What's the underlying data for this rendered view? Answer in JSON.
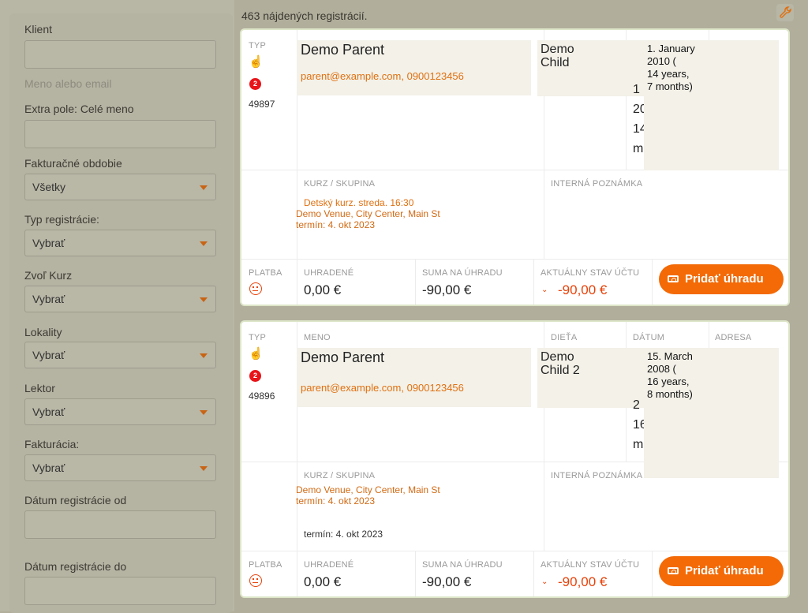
{
  "filters": {
    "client_label": "Klient",
    "client_hint": "Meno alebo email",
    "extra_label": "Extra pole: Celé meno",
    "period_label": "Fakturačné obdobie",
    "period_value": "Všetky",
    "regtype_label": "Typ registrácie:",
    "regtype_value": "Vybrať",
    "course_label": "Zvoľ Kurz",
    "course_value": "Vybrať",
    "location_label": "Lokality",
    "location_value": "Vybrať",
    "lector_label": "Lektor",
    "lector_value": "Vybrať",
    "billing_label": "Fakturácia:",
    "billing_value": "Vybrať",
    "date_from_label": "Dátum registrácie od",
    "date_to_label": "Dátum registrácie do"
  },
  "results_count": "463 nájdených registrácií.",
  "columns": {
    "typ": "TYP",
    "meno": "MENO",
    "dieta": "DIEŤA",
    "datum": "DÁTUM",
    "adresa": "ADRESA",
    "kurz": "KURZ / SKUPINA",
    "poznamka": "INTERNÁ POZNÁMKA",
    "platba": "PLATBA",
    "uhradene": "UHRADENÉ",
    "suma": "SUMA NA ÚHRADU",
    "stav": "AKTUÁLNY STAV ÚČTU"
  },
  "registrations": [
    {
      "id": "49897",
      "badge": "2",
      "parent": "Demo Parent",
      "contact": "parent@example.com, 0900123456",
      "child": "Demo\nChild",
      "birth": "1. January\n2010 (\n14 years,\n7 months)",
      "birth_cut": "1\n20\n14\nm",
      "course_link": "Detský kurz. streda. 16:30",
      "venue": "Demo Venue, City Center, Main St",
      "term": "termín: 4. okt 2023",
      "term_extra": "",
      "paid": "0,00 €",
      "due": "-90,00 €",
      "balance": "-90,00 €",
      "button": "Pridať úhradu"
    },
    {
      "id": "49896",
      "badge": "2",
      "parent": "Demo Parent",
      "contact": "parent@example.com, 0900123456",
      "child": "Demo\nChild 2",
      "birth": "15. March\n2008 (\n16 years,\n8 months)",
      "birth_cut": "2\n16\nm",
      "course_link": "",
      "venue": "Demo Venue, City Center, Main St",
      "term": "termín: 4. okt 2023",
      "term_extra": "termín: 4. okt 2023",
      "paid": "0,00 €",
      "due": "-90,00 €",
      "balance": "-90,00 €",
      "button": "Pridať úhradu"
    }
  ],
  "colors": {
    "accent": "#f36a06",
    "negative": "#e8420a",
    "badge": "#e8141a"
  },
  "icons": {
    "type": "hand-pointer-icon",
    "payment": "frown-icon",
    "tools": "wrench-icon",
    "money": "money-bill-icon"
  }
}
